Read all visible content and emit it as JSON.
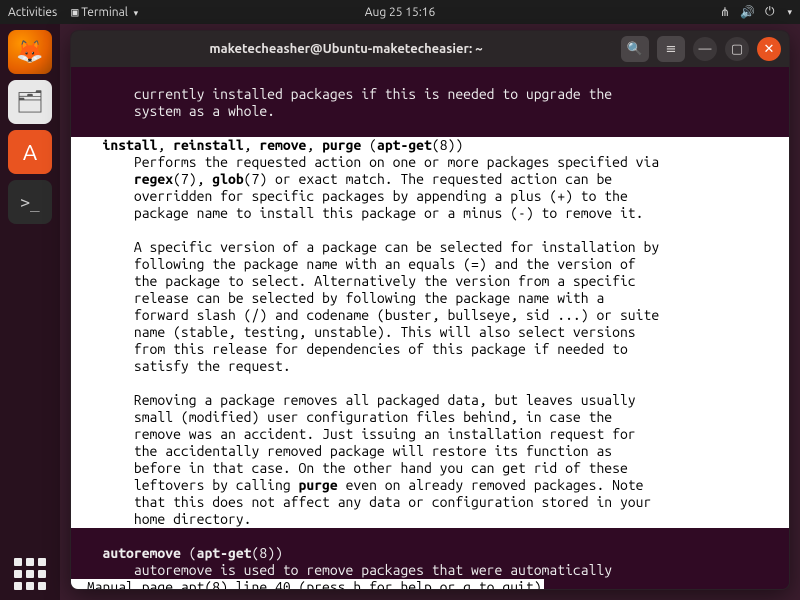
{
  "topbar": {
    "activities": "Activities",
    "app_indicator": "Terminal",
    "datetime": "Aug 25  15:16"
  },
  "dock": {
    "items": [
      {
        "name": "firefox",
        "glyph": "🦊"
      },
      {
        "name": "files",
        "glyph": "🗂"
      },
      {
        "name": "software",
        "glyph": "A"
      },
      {
        "name": "terminal",
        "glyph": ">_"
      }
    ]
  },
  "terminal": {
    "title": "maketecheasher@Ubuntu-maketecheasier: ~",
    "pre_lines": "       currently installed packages if this is needed to upgrade the\n       system as a whole.\n",
    "section_header_bold1": "install",
    "section_header_sep1": ", ",
    "section_header_bold2": "reinstall",
    "section_header_sep2": ", ",
    "section_header_bold3": "remove",
    "section_header_sep3": ", ",
    "section_header_bold4": "purge",
    "section_header_sep4": " (",
    "section_header_bold5": "apt-get",
    "section_header_tail": "(8))",
    "para1_l1": "       Performs the requested action on one or more packages specified via",
    "para1_l2a": "       ",
    "para1_l2b": "regex",
    "para1_l2c": "(7), ",
    "para1_l2d": "glob",
    "para1_l2e": "(7) or exact match. The requested action can be",
    "para1_l3": "       overridden for specific packages by appending a plus (+) to the",
    "para1_l4": "       package name to install this package or a minus (-) to remove it.",
    "para2": "       A specific version of a package can be selected for installation by\n       following the package name with an equals (=) and the version of\n       the package to select. Alternatively the version from a specific\n       release can be selected by following the package name with a\n       forward slash (/) and codename (buster, bullseye, sid ...) or suite\n       name (stable, testing, unstable). This will also select versions\n       from this release for dependencies of this package if needed to\n       satisfy the request.",
    "para3_pre": "       Removing a package removes all packaged data, but leaves usually\n       small (modified) user configuration files behind, in case the\n       remove was an accident. Just issuing an installation request for\n       the accidentally removed package will restore its function as\n       before in that case. On the other hand you can get rid of these\n       leftovers by calling ",
    "para3_bold": "purge",
    "para3_post": " even on already removed packages. Note\n       that this does not affect any data or configuration stored in your\n       home directory.\n",
    "section2_indent": "   ",
    "section2_bold1": "autoremove",
    "section2_mid": " (",
    "section2_bold2": "apt-get",
    "section2_tail": "(8))",
    "section2_line": "       autoremove is used to remove packages that were automatically",
    "status": " Manual page apt(8) line 40 (press h for help or q to quit)"
  }
}
